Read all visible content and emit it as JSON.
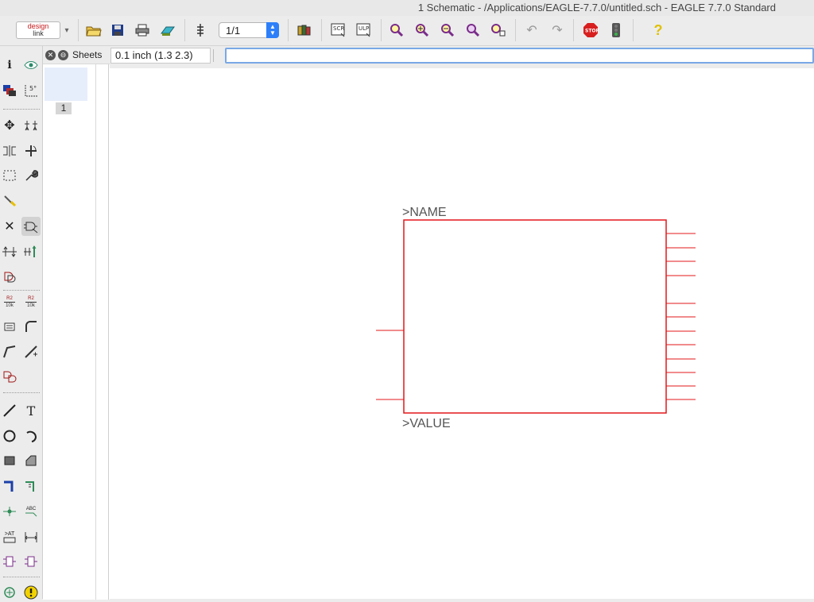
{
  "window": {
    "title": "1 Schematic - /Applications/EAGLE-7.7.0/untitled.sch - EAGLE 7.7.0 Standard"
  },
  "toolbar": {
    "logo_line1": "design",
    "logo_line2": "link",
    "sheet_selector": "1/1",
    "stop_label": "STOP",
    "scr_label": "SCR",
    "ulp_label": "ULP"
  },
  "sheets": {
    "title": "Sheets",
    "items": [
      "1"
    ]
  },
  "status": {
    "coordinate": "0.1 inch (1.3 2.3)",
    "command_value": ""
  },
  "schematic": {
    "name_label": ">NAME",
    "value_label": ">VALUE",
    "symbol_color": "#e3171a"
  },
  "palette": {
    "r2_label": "R2",
    "r2_value": "10k",
    "abc_label": "ABC",
    "att_label": ">AT",
    "text_tool": "T"
  }
}
